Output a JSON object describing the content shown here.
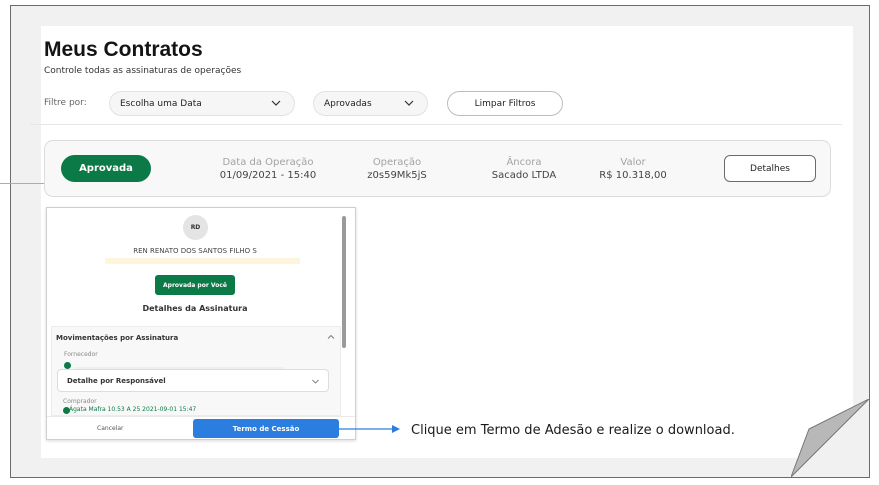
{
  "header": {
    "title": "Meus Contratos",
    "subtitle": "Controle todas as assinaturas de operações"
  },
  "filters": {
    "label": "Filtre por:",
    "date_select": "Escolha uma Data",
    "status_select": "Aprovadas",
    "clear_label": "Limpar Filtros"
  },
  "contract": {
    "status": "Aprovada",
    "date_label": "Data da Operação",
    "date_value": "01/09/2021 - 15:40",
    "operation_label": "Operação",
    "operation_value": "z0s59Mk5jS",
    "anchor_label": "Âncora",
    "anchor_value": "Sacado LTDA",
    "value_label": "Valor",
    "value_value": "R$ 10.318,00",
    "details_label": "Detalhes"
  },
  "modal": {
    "avatar_initials": "RD",
    "signer_line": "REN⁠ RENATO DOS SANTOS FILHO S",
    "approved_label": "Aprovada por Você",
    "section_title": "Detalhes da Assinatura",
    "accordion_title": "Movimentações por Assinatura",
    "supplier_label": "Fornecedor",
    "dropdown_label": "Detalhe por Responsável",
    "buyer_label": "Comprador",
    "buyer_value": "Ágata Mafra 10.53 A 25 2021-09-01 15:47",
    "cancel_label": "Cancelar",
    "term_label": "Termo de Cessão"
  },
  "callout": {
    "text": "Clique em Termo de Adesão e realize o download."
  },
  "colors": {
    "brand_green": "#0c7a47",
    "action_blue": "#2b7de0",
    "accent_yellow": "#e0b400"
  },
  "icons": [
    "chevron-down-icon",
    "chevron-up-icon",
    "check-circle-icon",
    "arrow-right-icon"
  ]
}
